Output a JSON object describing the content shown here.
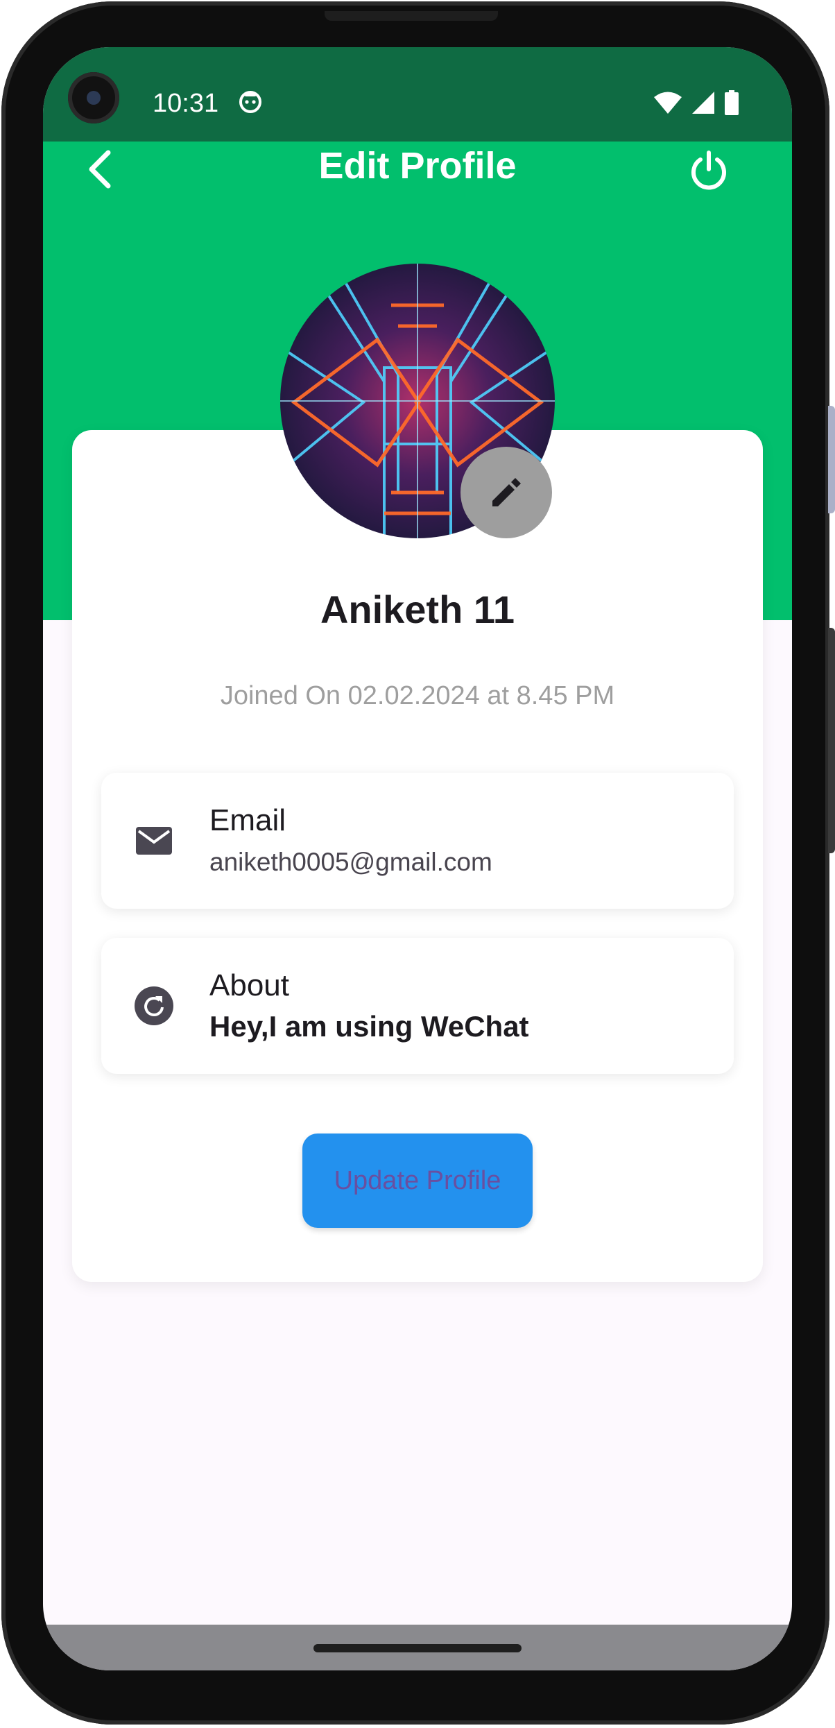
{
  "status_bar": {
    "time": "10:31",
    "notification_icon": "android-face-icon",
    "wifi_icon": "wifi-icon",
    "signal_icon": "cell-signal-icon",
    "battery_icon": "battery-icon"
  },
  "header": {
    "title": "Edit Profile",
    "back_icon": "chevron-left-icon",
    "power_icon": "power-icon"
  },
  "profile": {
    "name": "Aniketh 11",
    "joined": "Joined On 02.02.2024 at 8.45 PM",
    "edit_icon": "pencil-icon"
  },
  "tiles": {
    "email": {
      "label": "Email",
      "value": "aniketh0005@gmail.com",
      "icon": "envelope-icon"
    },
    "about": {
      "label": "About",
      "value": "Hey,I am using WeChat",
      "icon": "refresh-circle-icon"
    }
  },
  "actions": {
    "update_label": "Update Profile"
  },
  "colors": {
    "status_bar": "#0f6b43",
    "header": "#02bf6d",
    "button": "#2391ee",
    "button_text": "#6a4fa0",
    "card": "#ffffff",
    "background": "#fdf9fe"
  }
}
